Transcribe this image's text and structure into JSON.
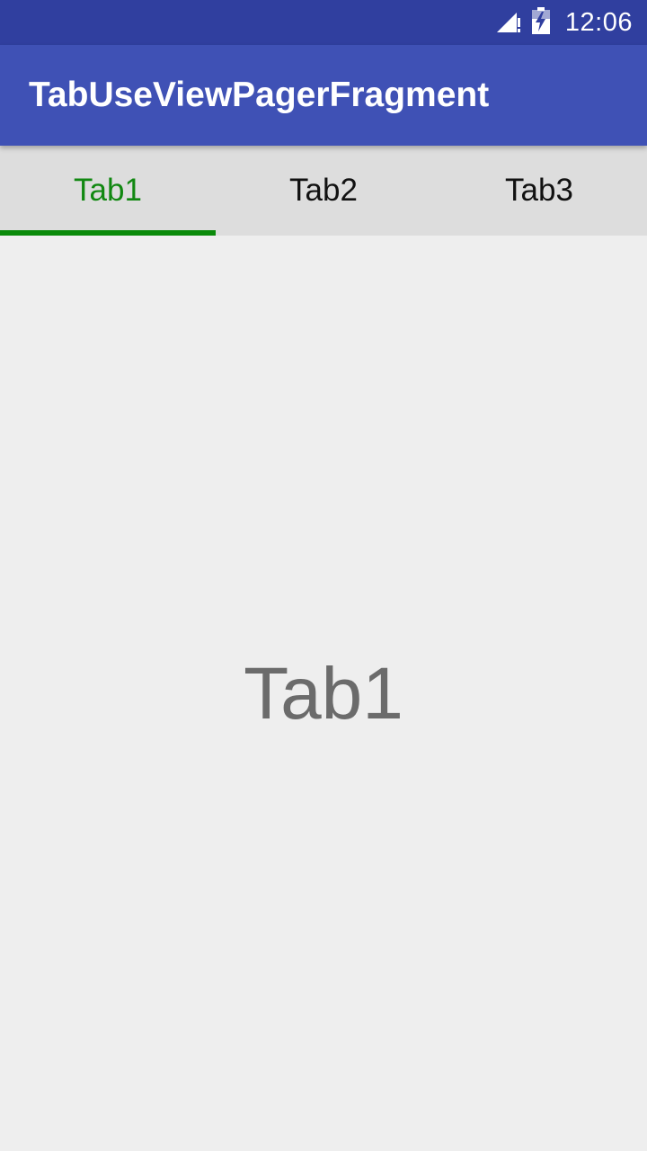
{
  "status_bar": {
    "time": "12:06",
    "icons": [
      "signal-no-data-icon",
      "battery-charging-icon"
    ]
  },
  "app_bar": {
    "title": "TabUseViewPagerFragment"
  },
  "tabs": [
    {
      "label": "Tab1",
      "selected": true
    },
    {
      "label": "Tab2",
      "selected": false
    },
    {
      "label": "Tab3",
      "selected": false
    }
  ],
  "content": {
    "text": "Tab1"
  },
  "colors": {
    "status_bar": "#303f9f",
    "app_bar": "#3f51b5",
    "tab_bar": "#dddddd",
    "tab_selected_text": "#118811",
    "tab_indicator": "#0a8a0a",
    "background": "#eeeeee"
  }
}
